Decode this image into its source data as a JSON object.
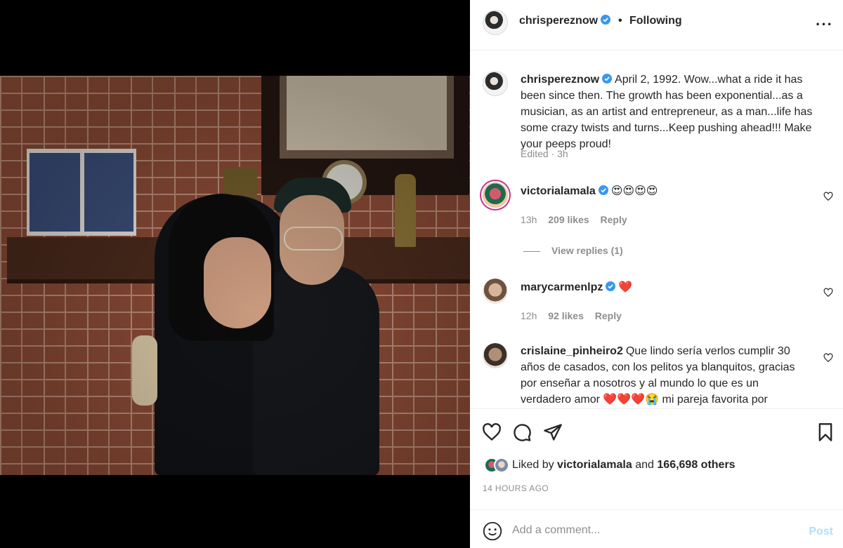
{
  "post": {
    "author": "chrispereznow",
    "follow_status": "Following",
    "more_icon": "more-horizontal-icon",
    "caption_text": "April 2, 1992. Wow...what a ride it has been since then. The growth has been exponential...as a musician, as an artist and entrepreneur, as a man...life has some crazy twists and turns...Keep pushing ahead!!! Make your peeps proud!",
    "caption_meta": "Edited · 3h"
  },
  "comments": [
    {
      "username": "victorialamala",
      "verified": true,
      "text": "😍😍😍😍",
      "time": "13h",
      "likes": "209 likes",
      "reply": "Reply",
      "view_replies": "View replies (1)"
    },
    {
      "username": "marycarmenlpz",
      "verified": true,
      "text": "❤️",
      "time": "12h",
      "likes": "92 likes",
      "reply": "Reply"
    },
    {
      "username": "crislaine_pinheiro2",
      "verified": false,
      "text": "Que lindo sería verlos cumplir 30 años de casados, con los pelitos ya blanquitos, gracias por enseñar a nosotros y al mundo lo que es un verdadero amor ❤️❤️❤️😭 mi pareja favorita por siempre!!"
    }
  ],
  "actions": {
    "like_icon": "heart-icon",
    "comment_icon": "comment-icon",
    "share_icon": "share-icon",
    "save_icon": "bookmark-icon"
  },
  "likes": {
    "prefix": "Liked by",
    "user": "victorialamala",
    "middle": "and",
    "others": "166,698 others"
  },
  "timestamp": "14 HOURS AGO",
  "comment_box": {
    "placeholder": "Add a comment...",
    "post_label": "Post"
  },
  "colors": {
    "verified_blue": "#3897f0",
    "post_disabled": "#b2dffc",
    "muted_text": "#8e8e8e"
  }
}
